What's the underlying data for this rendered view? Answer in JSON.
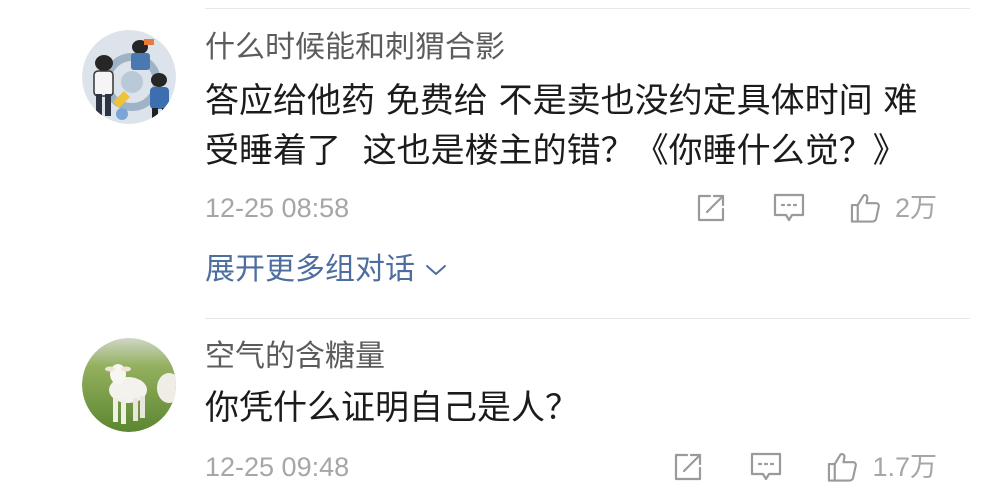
{
  "theme": {
    "background": "#ffffff",
    "username_color": "#5c5c5c",
    "text_color": "#1b1b1b",
    "meta_color": "#a6a6a6",
    "icon_color": "#9a9a9a",
    "link_color": "#4e6e9f",
    "divider_color": "#e8e8e8"
  },
  "icons": {
    "share": "share-icon",
    "reply": "comment-icon",
    "like": "thumbs-up-icon",
    "expand": "chevron-down-icon"
  },
  "comments": [
    {
      "username": "什么时候能和刺猬合影",
      "text_lines": [
        "答应给他药 免费给 不是卖也没约定具体时间 难",
        "受睡着了  这也是楼主的错？《你睡什么觉？》"
      ],
      "timestamp": "12-25 08:58",
      "like_count": "2万"
    },
    {
      "username": "空气的含糖量",
      "text_lines": [
        "你凭什么证明自己是人？"
      ],
      "timestamp": "12-25 09:48",
      "like_count": "1.7万"
    }
  ],
  "expand_thread": {
    "label": "展开更多组对话"
  }
}
